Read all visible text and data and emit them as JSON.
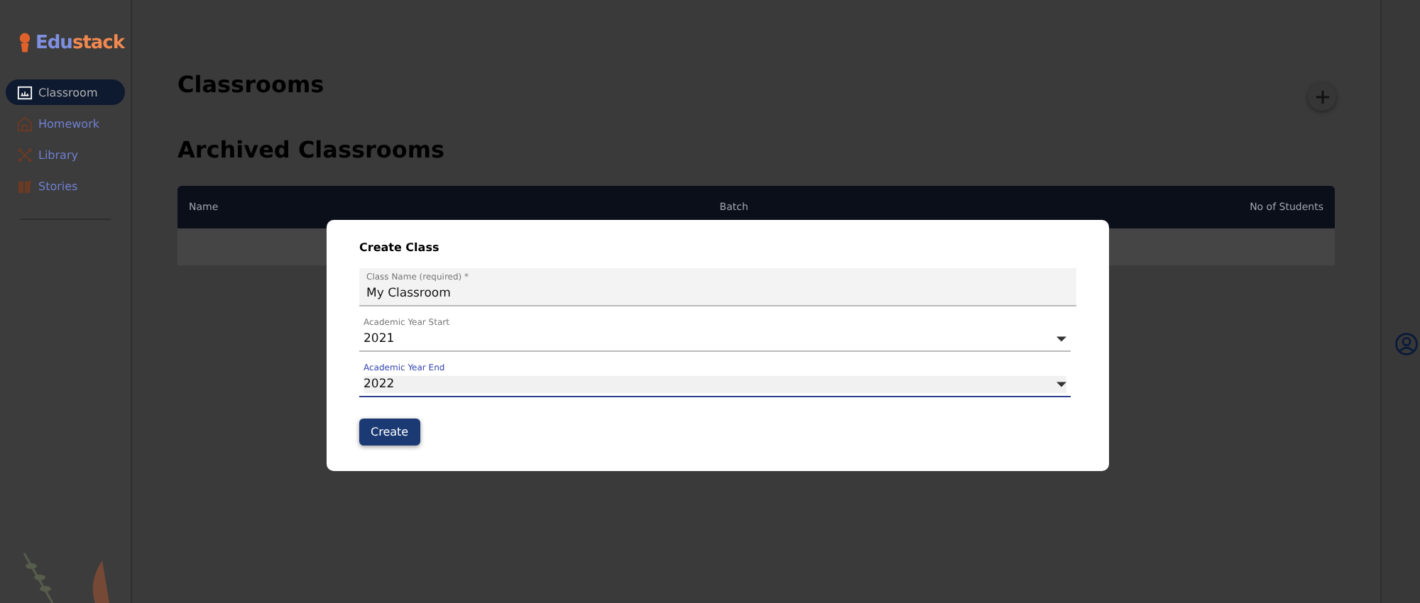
{
  "logo": {
    "part_1": "Edu",
    "part_2": "stack"
  },
  "sidebar": {
    "items": [
      {
        "label": "Classroom",
        "selected": true
      },
      {
        "label": "Homework",
        "selected": false
      },
      {
        "label": "Library",
        "selected": false
      },
      {
        "label": "Stories",
        "selected": false
      }
    ]
  },
  "main": {
    "title": "Classrooms",
    "archived_title": "Archived Classrooms",
    "table": {
      "columns": [
        "Name",
        "Batch",
        "No of Students"
      ]
    }
  },
  "dialog": {
    "title": "Create Class",
    "fields": [
      {
        "kind": "text",
        "label": "Class Name (required) *",
        "value": "My Classroom",
        "focused": false
      },
      {
        "kind": "select",
        "label": "Academic Year Start",
        "value": "2021",
        "focused": false
      },
      {
        "kind": "select",
        "label": "Academic Year End",
        "value": "2022",
        "focused": true
      }
    ],
    "button": "Create"
  }
}
